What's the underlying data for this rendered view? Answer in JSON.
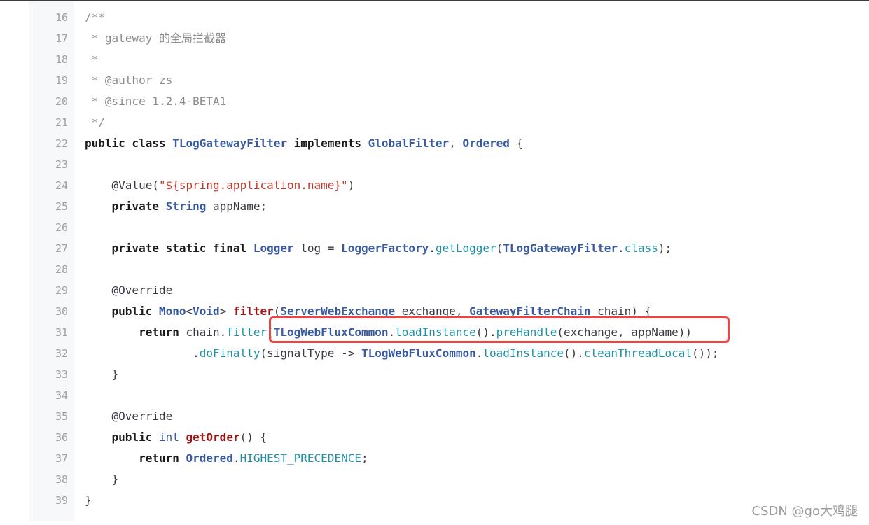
{
  "code": {
    "lines": [
      {
        "n": "16",
        "tokens": [
          {
            "t": "/**",
            "c": "comment"
          }
        ]
      },
      {
        "n": "17",
        "tokens": [
          {
            "t": " * gateway 的全局拦截器",
            "c": "comment"
          }
        ]
      },
      {
        "n": "18",
        "tokens": [
          {
            "t": " *",
            "c": "comment"
          }
        ]
      },
      {
        "n": "19",
        "tokens": [
          {
            "t": " * @author zs",
            "c": "comment"
          }
        ]
      },
      {
        "n": "20",
        "tokens": [
          {
            "t": " * @since 1.2.4-BETA1",
            "c": "comment"
          }
        ]
      },
      {
        "n": "21",
        "tokens": [
          {
            "t": " */",
            "c": "comment"
          }
        ]
      },
      {
        "n": "22",
        "tokens": [
          {
            "t": "public class ",
            "c": "kw"
          },
          {
            "t": "TLogGatewayFilter",
            "c": "type"
          },
          {
            "t": " implements ",
            "c": "kw"
          },
          {
            "t": "GlobalFilter",
            "c": "type"
          },
          {
            "t": ", ",
            "c": "plain"
          },
          {
            "t": "Ordered",
            "c": "type"
          },
          {
            "t": " {",
            "c": "plain"
          }
        ]
      },
      {
        "n": "23",
        "tokens": []
      },
      {
        "n": "24",
        "tokens": [
          {
            "t": "    @Value(",
            "c": "anno"
          },
          {
            "t": "\"${spring.application.name}\"",
            "c": "str"
          },
          {
            "t": ")",
            "c": "plain"
          }
        ]
      },
      {
        "n": "25",
        "tokens": [
          {
            "t": "    private ",
            "c": "kw"
          },
          {
            "t": "String",
            "c": "type"
          },
          {
            "t": " appName;",
            "c": "plain"
          }
        ]
      },
      {
        "n": "26",
        "tokens": []
      },
      {
        "n": "27",
        "tokens": [
          {
            "t": "    private static final ",
            "c": "kw"
          },
          {
            "t": "Logger",
            "c": "type"
          },
          {
            "t": " log = ",
            "c": "plain"
          },
          {
            "t": "LoggerFactory",
            "c": "type"
          },
          {
            "t": ".",
            "c": "plain"
          },
          {
            "t": "getLogger",
            "c": "call"
          },
          {
            "t": "(",
            "c": "plain"
          },
          {
            "t": "TLogGatewayFilter",
            "c": "type"
          },
          {
            "t": ".",
            "c": "plain"
          },
          {
            "t": "class",
            "c": "call"
          },
          {
            "t": ");",
            "c": "plain"
          }
        ]
      },
      {
        "n": "28",
        "tokens": []
      },
      {
        "n": "29",
        "tokens": [
          {
            "t": "    @Override",
            "c": "anno"
          }
        ]
      },
      {
        "n": "30",
        "tokens": [
          {
            "t": "    public ",
            "c": "kw"
          },
          {
            "t": "Mono",
            "c": "type"
          },
          {
            "t": "<",
            "c": "plain"
          },
          {
            "t": "Void",
            "c": "type"
          },
          {
            "t": "> ",
            "c": "plain"
          },
          {
            "t": "filter",
            "c": "fn"
          },
          {
            "t": "(",
            "c": "plain"
          },
          {
            "t": "ServerWebExchange",
            "c": "type"
          },
          {
            "t": " exchange, ",
            "c": "plain"
          },
          {
            "t": "GatewayFilterChain",
            "c": "type"
          },
          {
            "t": " chain) {",
            "c": "plain"
          }
        ]
      },
      {
        "n": "31",
        "tokens": [
          {
            "t": "        return ",
            "c": "kw"
          },
          {
            "t": "chain.",
            "c": "plain"
          },
          {
            "t": "filter",
            "c": "call"
          },
          {
            "t": "(",
            "c": "plain"
          },
          {
            "t": "TLogWebFluxCommon",
            "c": "type"
          },
          {
            "t": ".",
            "c": "plain"
          },
          {
            "t": "loadInstance",
            "c": "call"
          },
          {
            "t": "().",
            "c": "plain"
          },
          {
            "t": "preHandle",
            "c": "call"
          },
          {
            "t": "(exchange, appName))",
            "c": "plain"
          }
        ]
      },
      {
        "n": "32",
        "tokens": [
          {
            "t": "                .",
            "c": "plain"
          },
          {
            "t": "doFinally",
            "c": "call"
          },
          {
            "t": "(signalType -> ",
            "c": "plain"
          },
          {
            "t": "TLogWebFluxCommon",
            "c": "type"
          },
          {
            "t": ".",
            "c": "plain"
          },
          {
            "t": "loadInstance",
            "c": "call"
          },
          {
            "t": "().",
            "c": "plain"
          },
          {
            "t": "cleanThreadLocal",
            "c": "call"
          },
          {
            "t": "());",
            "c": "plain"
          }
        ]
      },
      {
        "n": "33",
        "tokens": [
          {
            "t": "    }",
            "c": "plain"
          }
        ]
      },
      {
        "n": "34",
        "tokens": []
      },
      {
        "n": "35",
        "tokens": [
          {
            "t": "    @Override",
            "c": "anno"
          }
        ]
      },
      {
        "n": "36",
        "tokens": [
          {
            "t": "    public ",
            "c": "kw"
          },
          {
            "t": "int",
            "c": "prim"
          },
          {
            "t": " ",
            "c": "plain"
          },
          {
            "t": "getOrder",
            "c": "fn"
          },
          {
            "t": "() {",
            "c": "plain"
          }
        ]
      },
      {
        "n": "37",
        "tokens": [
          {
            "t": "        return ",
            "c": "kw"
          },
          {
            "t": "Ordered",
            "c": "type"
          },
          {
            "t": ".",
            "c": "plain"
          },
          {
            "t": "HIGHEST_PRECEDENCE",
            "c": "call"
          },
          {
            "t": ";",
            "c": "plain"
          }
        ]
      },
      {
        "n": "38",
        "tokens": [
          {
            "t": "    }",
            "c": "plain"
          }
        ]
      },
      {
        "n": "39",
        "tokens": [
          {
            "t": "}",
            "c": "plain"
          }
        ]
      }
    ]
  },
  "highlight": {
    "color": "#e84545"
  },
  "watermark": {
    "text": "CSDN @go大鸡腿"
  }
}
